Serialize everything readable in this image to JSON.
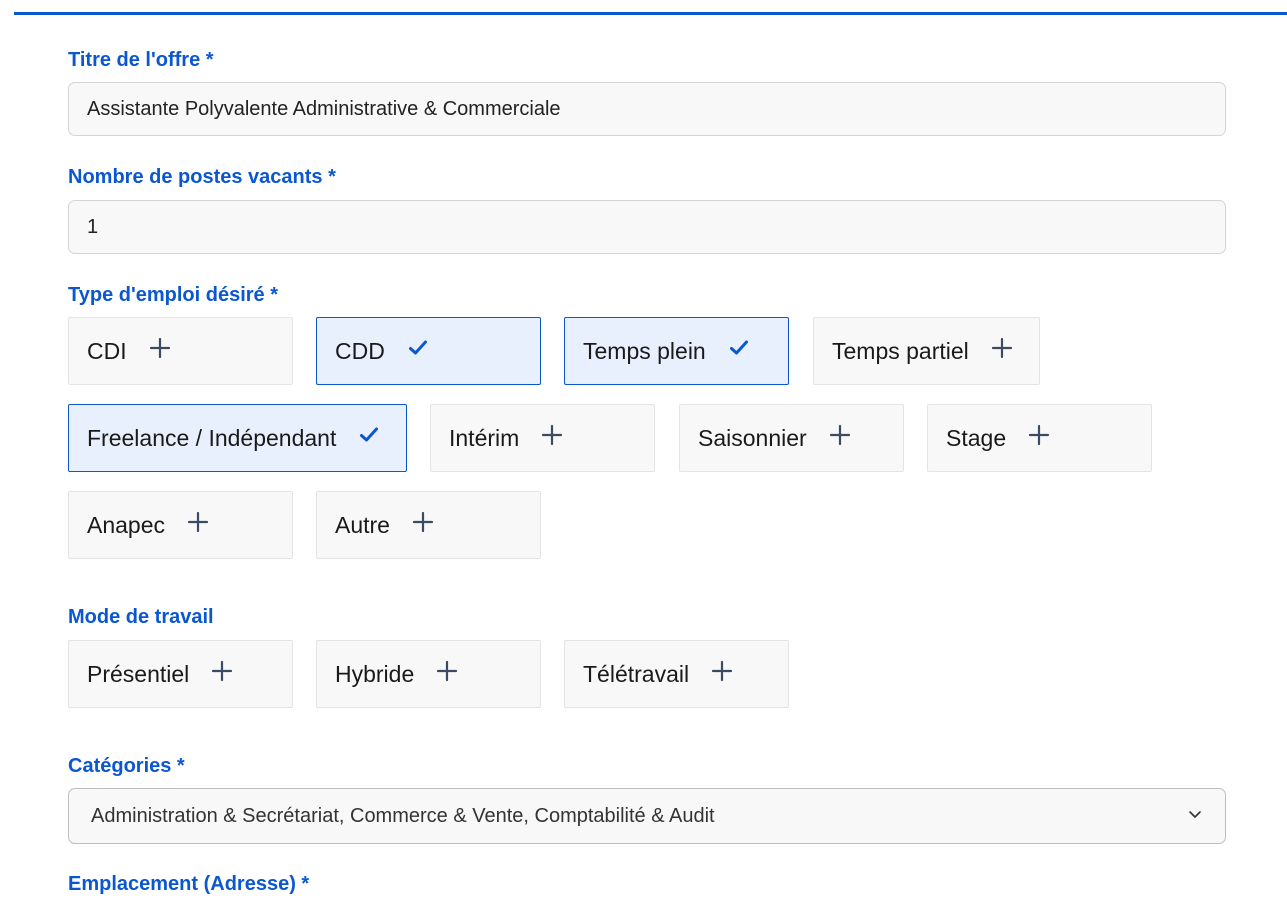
{
  "form": {
    "title_field": {
      "label": "Titre de l'offre *",
      "value": "Assistante Polyvalente Administrative & Commerciale"
    },
    "vacancies_field": {
      "label": "Nombre de postes vacants *",
      "value": "1"
    },
    "employment_type": {
      "label": "Type d'emploi désiré *",
      "options": [
        {
          "label": "CDI",
          "selected": false
        },
        {
          "label": "CDD",
          "selected": true
        },
        {
          "label": "Temps plein",
          "selected": true
        },
        {
          "label": "Temps partiel",
          "selected": false
        },
        {
          "label": "Freelance / Indépendant",
          "selected": true
        },
        {
          "label": "Intérim",
          "selected": false
        },
        {
          "label": "Saisonnier",
          "selected": false
        },
        {
          "label": "Stage",
          "selected": false
        },
        {
          "label": "Anapec",
          "selected": false
        },
        {
          "label": "Autre",
          "selected": false
        }
      ]
    },
    "work_mode": {
      "label": "Mode de travail",
      "options": [
        {
          "label": "Présentiel",
          "selected": false
        },
        {
          "label": "Hybride",
          "selected": false
        },
        {
          "label": "Télétravail",
          "selected": false
        }
      ]
    },
    "categories": {
      "label": "Catégories *",
      "value": "Administration & Secrétariat, Commerce & Vente, Comptabilité & Audit"
    },
    "location": {
      "label": "Emplacement (Adresse) *"
    }
  },
  "colors": {
    "accent": "#0b57d0",
    "selected_bg": "#e8f0fe",
    "field_bg": "#f8f8f8",
    "plus_icon": "#3c4a63"
  },
  "icons": {
    "add": "plus-icon",
    "selected": "check-icon",
    "dropdown": "chevron-down-icon"
  }
}
